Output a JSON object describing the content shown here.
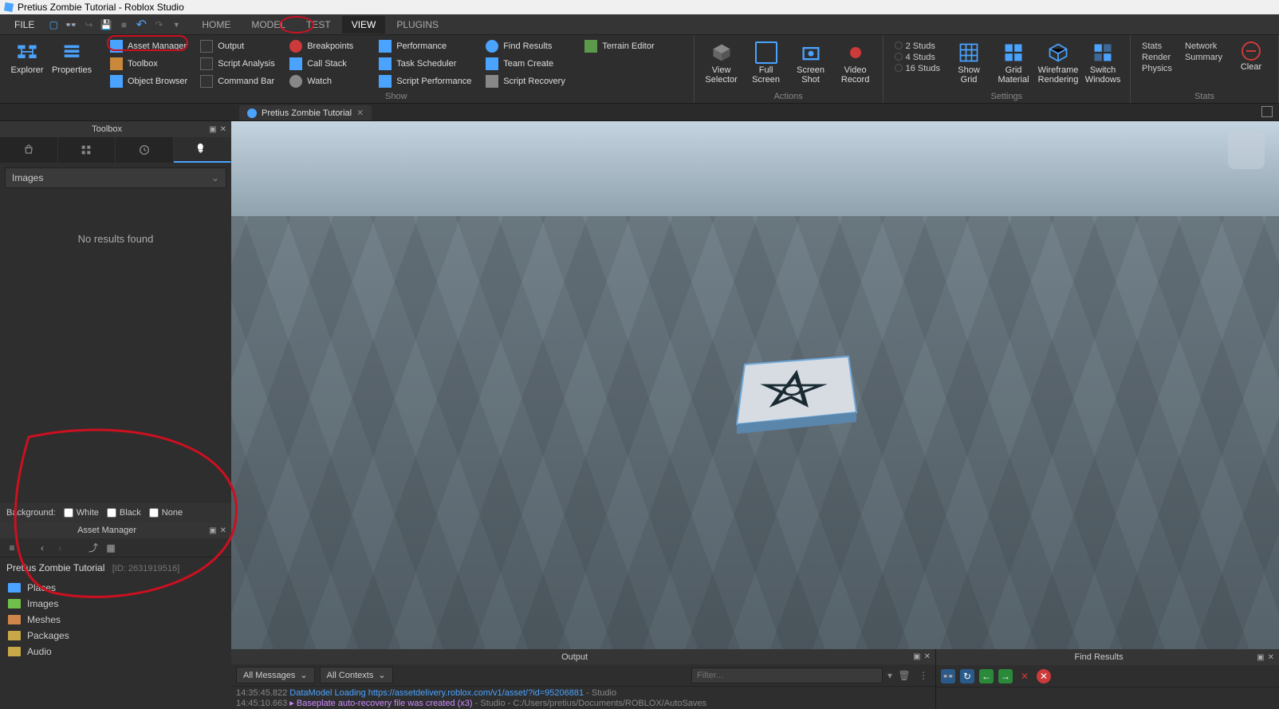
{
  "window": {
    "title": "Pretius Zombie Tutorial - Roblox Studio"
  },
  "menu": {
    "file": "FILE",
    "tabs": [
      "HOME",
      "MODEL",
      "TEST",
      "VIEW",
      "PLUGINS"
    ],
    "active_tab": "VIEW"
  },
  "ribbon": {
    "explorer": "Explorer",
    "properties": "Properties",
    "asset_manager": "Asset Manager",
    "toolbox": "Toolbox",
    "object_browser": "Object Browser",
    "output": "Output",
    "script_analysis": "Script Analysis",
    "command_bar": "Command Bar",
    "breakpoints": "Breakpoints",
    "call_stack": "Call Stack",
    "watch": "Watch",
    "performance": "Performance",
    "task_scheduler": "Task Scheduler",
    "script_performance": "Script Performance",
    "find_results": "Find Results",
    "team_create": "Team Create",
    "script_recovery": "Script Recovery",
    "terrain_editor": "Terrain Editor",
    "show_label": "Show",
    "view_selector": "View Selector",
    "full_screen": "Full Screen",
    "screen_shot": "Screen Shot",
    "video_record": "Video Record",
    "actions_label": "Actions",
    "studs": {
      "s2": "2 Studs",
      "s4": "4 Studs",
      "s16": "16 Studs"
    },
    "show_grid": "Show Grid",
    "grid_material": "Grid Material",
    "wireframe": "Wireframe Rendering",
    "switch_windows": "Switch Windows",
    "settings_label": "Settings",
    "stats": "Stats",
    "render": "Render",
    "physics": "Physics",
    "network": "Network",
    "summary": "Summary",
    "clear": "Clear",
    "stats_label": "Stats"
  },
  "doctab": {
    "label": "Pretius Zombie Tutorial"
  },
  "toolbox": {
    "title": "Toolbox",
    "dropdown": "Images",
    "noresults": "No results found",
    "background_label": "Background:",
    "bg_white": "White",
    "bg_black": "Black",
    "bg_none": "None"
  },
  "asset_manager": {
    "title": "Asset Manager",
    "project": "Pretius Zombie Tutorial",
    "id": "[ID: 2631919516]",
    "folders": [
      {
        "name": "Places",
        "color": "#4aa3ff"
      },
      {
        "name": "Images",
        "color": "#6fbf4a"
      },
      {
        "name": "Meshes",
        "color": "#d0864a"
      },
      {
        "name": "Packages",
        "color": "#c9a84a"
      },
      {
        "name": "Audio",
        "color": "#c9a84a"
      }
    ]
  },
  "output": {
    "title": "Output",
    "all_messages": "All Messages",
    "all_contexts": "All Contexts",
    "filter_placeholder": "Filter...",
    "lines": [
      {
        "ts": "14:35:45.822",
        "link": "DataModel Loading https://assetdelivery.roblox.com/v1/asset/?id=95206881",
        "tail": " - Studio"
      },
      {
        "ts": "14:45:10.663",
        "warn": "▸ Baseplate auto-recovery file was created (x3)",
        "tail": " - Studio - C:/Users/pretius/Documents/ROBLOX/AutoSaves"
      }
    ]
  },
  "find_results": {
    "title": "Find Results"
  }
}
